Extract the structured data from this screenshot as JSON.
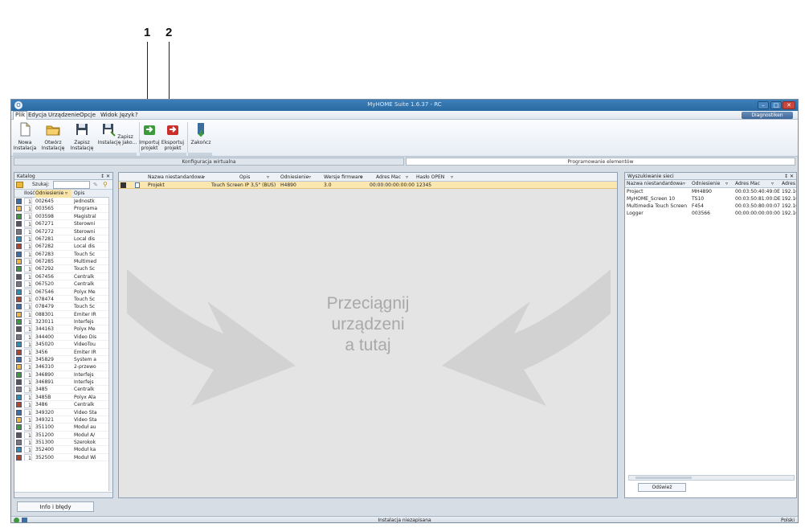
{
  "callouts": {
    "one": "1",
    "two": "2"
  },
  "window": {
    "title": "MyHOME Suite 1.6.37 - RC",
    "app_icon": "O"
  },
  "menu": {
    "items": [
      "Plik",
      "Edycja",
      "Urządzenie",
      "Opcje",
      "Widok",
      "Język",
      "?"
    ],
    "diagnostics": "Diagnostiken"
  },
  "ribbon": {
    "new_label": "Nowa\nInstalacja",
    "open_label": "Otwórz\nInstalację",
    "save_label": "Zapisz\nInstalację",
    "save_as_label": "Zapisz\nInstalację Jako...",
    "import_label": "Importuj\nprojekt",
    "export_label": "Eksportuj\nprojekt",
    "close_label": "Zakończ"
  },
  "mode_tabs": {
    "virtual": "Konfiguracja wirtualna",
    "programming": "Programowanie elementów"
  },
  "catalog": {
    "title": "Katalog",
    "search_label": "Szukaj:",
    "search_value": "",
    "col_qty": "Ilość",
    "col_ref": "Odniesienie",
    "col_desc": "Opis",
    "rows": [
      {
        "qty": "1",
        "ref": "002645",
        "desc": "Jednostk"
      },
      {
        "qty": "1",
        "ref": "003565",
        "desc": "Programa"
      },
      {
        "qty": "1",
        "ref": "003598",
        "desc": "Magistral"
      },
      {
        "qty": "1",
        "ref": "067271",
        "desc": "Sterowni"
      },
      {
        "qty": "1",
        "ref": "067272",
        "desc": "Sterowni"
      },
      {
        "qty": "1",
        "ref": "067281",
        "desc": "Local dis"
      },
      {
        "qty": "1",
        "ref": "067282",
        "desc": "Local dis"
      },
      {
        "qty": "1",
        "ref": "067283",
        "desc": "Touch Sc"
      },
      {
        "qty": "1",
        "ref": "067285",
        "desc": "Multimed"
      },
      {
        "qty": "1",
        "ref": "067292",
        "desc": "Touch Sc"
      },
      {
        "qty": "1",
        "ref": "067456",
        "desc": "Centralk"
      },
      {
        "qty": "1",
        "ref": "067520",
        "desc": "Centralk"
      },
      {
        "qty": "1",
        "ref": "067546",
        "desc": "Polyx Me"
      },
      {
        "qty": "1",
        "ref": "078474",
        "desc": "Touch Sc"
      },
      {
        "qty": "1",
        "ref": "078479",
        "desc": "Touch Sc"
      },
      {
        "qty": "1",
        "ref": "088301",
        "desc": "Emiter IR"
      },
      {
        "qty": "1",
        "ref": "323011",
        "desc": "Interfejs"
      },
      {
        "qty": "1",
        "ref": "344163",
        "desc": "Polyx Me"
      },
      {
        "qty": "1",
        "ref": "344400",
        "desc": "Video Dis"
      },
      {
        "qty": "1",
        "ref": "345020",
        "desc": "VideoTou"
      },
      {
        "qty": "1",
        "ref": "3456",
        "desc": "Emiter IR"
      },
      {
        "qty": "1",
        "ref": "345829",
        "desc": "System a"
      },
      {
        "qty": "1",
        "ref": "346310",
        "desc": "2-przewo"
      },
      {
        "qty": "1",
        "ref": "346890",
        "desc": "Interfejs"
      },
      {
        "qty": "1",
        "ref": "346891",
        "desc": "Interfejs"
      },
      {
        "qty": "1",
        "ref": "3485",
        "desc": "Centralk"
      },
      {
        "qty": "1",
        "ref": "3485B",
        "desc": "Polyx Ala"
      },
      {
        "qty": "1",
        "ref": "3486",
        "desc": "Centralk"
      },
      {
        "qty": "1",
        "ref": "349320",
        "desc": "Video Sta"
      },
      {
        "qty": "1",
        "ref": "349321",
        "desc": "Video Sta"
      },
      {
        "qty": "1",
        "ref": "351100",
        "desc": "Moduł au"
      },
      {
        "qty": "1",
        "ref": "351200",
        "desc": "Moduł A/"
      },
      {
        "qty": "1",
        "ref": "351300",
        "desc": "Szerokok"
      },
      {
        "qty": "1",
        "ref": "352400",
        "desc": "Moduł ka"
      },
      {
        "qty": "1",
        "ref": "352500",
        "desc": "Moduł Wi"
      }
    ]
  },
  "project_grid": {
    "columns": [
      "Nazwa niestandardowa",
      "Opis",
      "Odniesienie",
      "Wersje firmware",
      "Adres Mac",
      "Hasło OPEN"
    ],
    "row": {
      "name": "Projekt",
      "desc": "Touch Screen IP 3,5\" (BUS)",
      "ref": "H4890",
      "fw": "3.0",
      "mac": "00:00:00:00:00:00",
      "pwd": "12345"
    },
    "drop_hint": "Przeciągnij\nurządzeni\na tutaj"
  },
  "network": {
    "title": "Wyszukiwanie sieci",
    "columns": [
      "Nazwa niestandardowa",
      "Odniesienie",
      "Adres Mac",
      "Adres I"
    ],
    "rows": [
      {
        "name": "Project",
        "ref": "MH4890",
        "mac": "00:03:50:40:49:0E",
        "ip": "192.16"
      },
      {
        "name": "MyHOME_Screen 10",
        "ref": "TS10",
        "mac": "00:03:50:81:00:DE",
        "ip": "192.16"
      },
      {
        "name": "Multimedia Touch Screen",
        "ref": "F454",
        "mac": "00:03:50:80:00:07",
        "ip": "192.16"
      },
      {
        "name": "Logger",
        "ref": "003566",
        "mac": "00:00:00:00:00:00",
        "ip": "192.16"
      }
    ],
    "refresh_label": "Odśwież"
  },
  "bottom": {
    "info_label": "Info i błędy"
  },
  "status": {
    "center": "Instalacja niezapisana",
    "language": "Polski"
  },
  "colors": {
    "title_bar": "#2a6aa3",
    "selected_row": "#fde7b0",
    "arrow": "#d2d2d2",
    "drop_text": "#a9a9a9"
  }
}
